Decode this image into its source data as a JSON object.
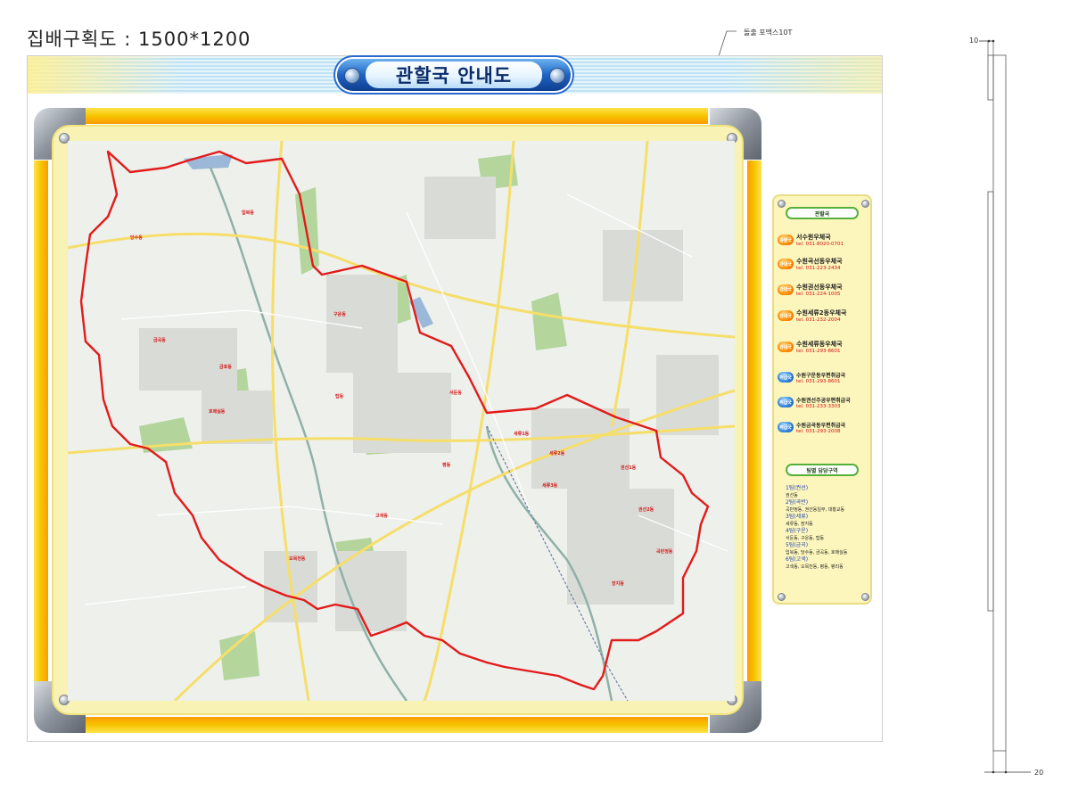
{
  "page_title": "집배구획도 : 1500*1200",
  "material_label": "돌출 포맥스10T",
  "board_title": "관할국 안내도",
  "legend": {
    "offices_header": "관할국",
    "offices": [
      {
        "badge": "총괄국",
        "name": "서수원우체국",
        "tel": "tel. 031-8020-0701",
        "badge_color": "orange"
      },
      {
        "badge": "관내국",
        "name": "수원곡선동우체국",
        "tel": "tel. 031-223-2434",
        "badge_color": "orange"
      },
      {
        "badge": "관내국",
        "name": "수원권선동우체국",
        "tel": "tel. 031-224-1005",
        "badge_color": "orange"
      },
      {
        "badge": "관내국",
        "name": "수원세류2동우체국",
        "tel": "tel. 031-232-2004",
        "badge_color": "orange"
      },
      {
        "badge": "관내국",
        "name": "수원세류동우체국",
        "tel": "tel. 031-293-8601",
        "badge_color": "orange"
      },
      {
        "badge": "취급국",
        "name": "수원구운동우편취급국",
        "tel": "tel. 031-293-8601",
        "badge_color": "blue"
      },
      {
        "badge": "취급국",
        "name": "수원권선주공우편취급국",
        "tel": "tel. 031-233-3303",
        "badge_color": "blue"
      },
      {
        "badge": "취급국",
        "name": "수원금곡동우편취급국",
        "tel": "tel. 031-293-2008",
        "badge_color": "blue"
      }
    ],
    "zones_header": "팀별 담당구역",
    "zones": [
      {
        "head": "1팀(권선)",
        "body": "권선동"
      },
      {
        "head": "2팀(곡반)",
        "body": "곡반정동, 권선동일부, 대황교동"
      },
      {
        "head": "3팀(세류)",
        "body": "세류동, 장지동"
      },
      {
        "head": "4팀(구운)",
        "body": "서둔동, 구운동, 탑동"
      },
      {
        "head": "5팀(금곡)",
        "body": "입북동, 당수동, 금곡동, 호매실동"
      },
      {
        "head": "6팀(고색)",
        "body": "고색동, 오목천동, 평동, 평리동"
      }
    ]
  },
  "map_labels": {
    "dangsu": "당수동",
    "ipbuk": "입북동",
    "geumgok": "금곡동",
    "homaesil": "호매실동",
    "gumgok2": "금호동",
    "guun": "구운동",
    "tap": "탑동",
    "seodun": "서둔동",
    "seryu1": "세류1동",
    "seryu2": "세류2동",
    "seryu3": "세류3동",
    "gwonseon1": "권선1동",
    "gwonseon2": "권선2동",
    "gokban": "곡반정동",
    "pyeong": "평동",
    "gosaek": "고색동",
    "omokcheon": "오목천동",
    "jangji": "장지동"
  },
  "dimensions": {
    "top": "10",
    "bottom": "20"
  },
  "colors": {
    "boundary": "#e21b1b",
    "frame_yellow": "#f5c400",
    "title_blue": "#1f63c3",
    "legend_bg": "#fdf6bc"
  }
}
